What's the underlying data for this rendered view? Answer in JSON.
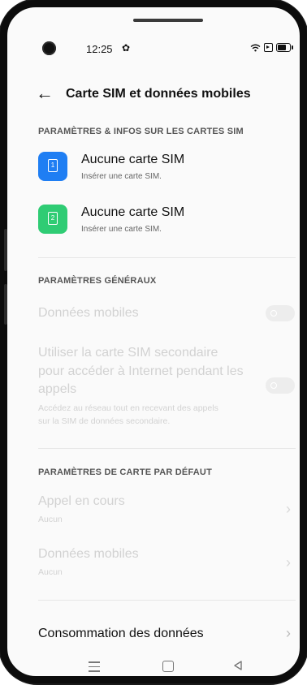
{
  "status_bar": {
    "time": "12:25",
    "battery_percent": 80,
    "icons": [
      "camera-punch-hole",
      "settings-gear-icon",
      "wifi-icon",
      "screen-record-icon",
      "battery-icon"
    ]
  },
  "header": {
    "back_icon": "arrow-left-icon",
    "title": "Carte SIM et données mobiles"
  },
  "sim_section": {
    "label": "PARAMÈTRES & INFOS SUR LES CARTES SIM",
    "sims": [
      {
        "slot": "1",
        "title": "Aucune carte SIM",
        "subtitle": "Insérer une carte SIM.",
        "color": "#1f7ef3"
      },
      {
        "slot": "2",
        "title": "Aucune carte SIM",
        "subtitle": "Insérer une carte SIM.",
        "color": "#2fcc74"
      }
    ]
  },
  "general_section": {
    "label": "PARAMÈTRES GÉNÉRAUX",
    "mobile_data": {
      "title": "Données mobiles",
      "enabled": false
    },
    "secondary_sim": {
      "title_line1": "Utiliser la carte SIM secondaire",
      "title_line2": "pour accéder à Internet pendant les",
      "title_line3": "appels",
      "desc_line1": "Accédez au réseau tout en recevant des appels",
      "desc_line2": "sur la SIM de données secondaire.",
      "enabled": false
    }
  },
  "default_section": {
    "label": "PARAMÈTRES DE CARTE PAR DÉFAUT",
    "call": {
      "title": "Appel en cours",
      "value": "Aucun"
    },
    "data": {
      "title": "Données mobiles",
      "value": "Aucun"
    }
  },
  "usage": {
    "title": "Consommation des données"
  },
  "navbar": {
    "icons": [
      "menu-icon",
      "home-icon",
      "back-triangle-icon"
    ]
  },
  "colors": {
    "disabled_text": "#d2d2d2",
    "section_label": "#555555"
  }
}
